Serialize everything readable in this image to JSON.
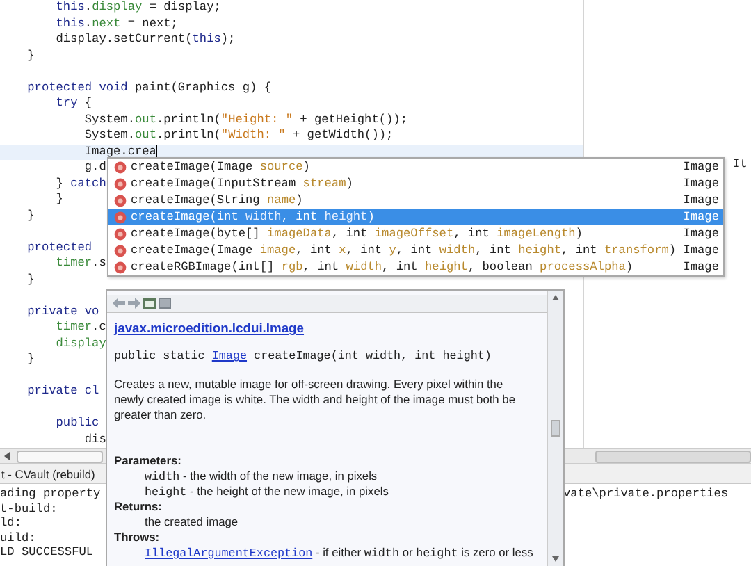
{
  "editor": {
    "lines": [
      {
        "current": false,
        "tokens": [
          {
            "text": "        this",
            "kind": "keyword"
          },
          {
            "text": ".",
            "kind": "plain"
          },
          {
            "text": "display",
            "kind": "field"
          },
          {
            "text": " = display;",
            "kind": "plain"
          }
        ]
      },
      {
        "current": false,
        "tokens": [
          {
            "text": "        this",
            "kind": "keyword"
          },
          {
            "text": ".",
            "kind": "plain"
          },
          {
            "text": "next",
            "kind": "field"
          },
          {
            "text": " = next;",
            "kind": "plain"
          }
        ]
      },
      {
        "current": false,
        "tokens": [
          {
            "text": "        display.setCurrent(",
            "kind": "plain"
          },
          {
            "text": "this",
            "kind": "keyword"
          },
          {
            "text": ");",
            "kind": "plain"
          }
        ]
      },
      {
        "current": false,
        "tokens": [
          {
            "text": "    }",
            "kind": "plain"
          }
        ]
      },
      {
        "current": false
      },
      {
        "current": false,
        "tokens": [
          {
            "text": "    protected void",
            "kind": "keyword"
          },
          {
            "text": " paint(Graphics g) {",
            "kind": "plain"
          }
        ]
      },
      {
        "current": false,
        "tokens": [
          {
            "text": "        try",
            "kind": "keyword"
          },
          {
            "text": " {",
            "kind": "plain"
          }
        ]
      },
      {
        "current": false,
        "tokens": [
          {
            "text": "            System.",
            "kind": "plain"
          },
          {
            "text": "out",
            "kind": "field"
          },
          {
            "text": ".println(",
            "kind": "plain"
          },
          {
            "text": "\"Height: \"",
            "kind": "string"
          },
          {
            "text": " + getHeight());",
            "kind": "plain"
          }
        ]
      },
      {
        "current": false,
        "tokens": [
          {
            "text": "            System.",
            "kind": "plain"
          },
          {
            "text": "out",
            "kind": "field"
          },
          {
            "text": ".println(",
            "kind": "plain"
          },
          {
            "text": "\"Width: \"",
            "kind": "string"
          },
          {
            "text": " + getWidth());",
            "kind": "plain"
          }
        ]
      },
      {
        "current": true,
        "tokens": [
          {
            "text": "            Image.crea",
            "kind": "plain"
          }
        ]
      },
      {
        "current": false,
        "tokens": [
          {
            "text": "            g.d",
            "kind": "plain"
          }
        ]
      },
      {
        "current": false,
        "tokens": [
          {
            "text": "        } ",
            "kind": "plain"
          },
          {
            "text": "catch",
            "kind": "keyword"
          }
        ]
      },
      {
        "current": false,
        "tokens": [
          {
            "text": "        }",
            "kind": "plain"
          }
        ]
      },
      {
        "current": false,
        "tokens": [
          {
            "text": "    }",
            "kind": "plain"
          }
        ]
      },
      {
        "current": false
      },
      {
        "current": false,
        "tokens": [
          {
            "text": "    protected",
            "kind": "keyword"
          }
        ]
      },
      {
        "current": false,
        "tokens": [
          {
            "text": "        timer",
            "kind": "field"
          },
          {
            "text": ".s",
            "kind": "plain"
          }
        ]
      },
      {
        "current": false,
        "tokens": [
          {
            "text": "    }",
            "kind": "plain"
          }
        ]
      },
      {
        "current": false
      },
      {
        "current": false,
        "tokens": [
          {
            "text": "    private vo",
            "kind": "keyword"
          }
        ]
      },
      {
        "current": false,
        "tokens": [
          {
            "text": "        timer",
            "kind": "field"
          },
          {
            "text": ".c",
            "kind": "plain"
          }
        ]
      },
      {
        "current": false,
        "tokens": [
          {
            "text": "        display",
            "kind": "field"
          }
        ]
      },
      {
        "current": false,
        "tokens": [
          {
            "text": "    }",
            "kind": "plain"
          }
        ]
      },
      {
        "current": false
      },
      {
        "current": false,
        "tokens": [
          {
            "text": "    private cl",
            "kind": "keyword"
          }
        ]
      },
      {
        "current": false
      },
      {
        "current": false,
        "tokens": [
          {
            "text": "        public",
            "kind": "keyword"
          }
        ]
      },
      {
        "current": false,
        "tokens": [
          {
            "text": "            dis",
            "kind": "plain"
          }
        ]
      }
    ]
  },
  "side_panel": {
    "text": "It"
  },
  "completion": {
    "items": [
      {
        "selected": false,
        "returns": "Image",
        "tokens": [
          {
            "text": "createImage(Image ",
            "kind": "plain"
          },
          {
            "text": "source",
            "kind": "param"
          },
          {
            "text": ")",
            "kind": "plain"
          }
        ]
      },
      {
        "selected": false,
        "returns": "Image",
        "tokens": [
          {
            "text": "createImage(InputStream ",
            "kind": "plain"
          },
          {
            "text": "stream",
            "kind": "param"
          },
          {
            "text": ")",
            "kind": "plain"
          }
        ]
      },
      {
        "selected": false,
        "returns": "Image",
        "tokens": [
          {
            "text": "createImage(String ",
            "kind": "plain"
          },
          {
            "text": "name",
            "kind": "param"
          },
          {
            "text": ")",
            "kind": "plain"
          }
        ]
      },
      {
        "selected": true,
        "returns": "Image",
        "tokens": [
          {
            "text": "createImage(int ",
            "kind": "plain"
          },
          {
            "text": "width",
            "kind": "param"
          },
          {
            "text": ", int ",
            "kind": "plain"
          },
          {
            "text": "height",
            "kind": "param"
          },
          {
            "text": ")",
            "kind": "plain"
          }
        ]
      },
      {
        "selected": false,
        "returns": "Image",
        "tokens": [
          {
            "text": "createImage(byte[] ",
            "kind": "plain"
          },
          {
            "text": "imageData",
            "kind": "param"
          },
          {
            "text": ", int ",
            "kind": "plain"
          },
          {
            "text": "imageOffset",
            "kind": "param"
          },
          {
            "text": ", int ",
            "kind": "plain"
          },
          {
            "text": "imageLength",
            "kind": "param"
          },
          {
            "text": ")",
            "kind": "plain"
          }
        ]
      },
      {
        "selected": false,
        "returns": "Image",
        "tokens": [
          {
            "text": "createImage(Image ",
            "kind": "plain"
          },
          {
            "text": "image",
            "kind": "param"
          },
          {
            "text": ", int ",
            "kind": "plain"
          },
          {
            "text": "x",
            "kind": "param"
          },
          {
            "text": ", int ",
            "kind": "plain"
          },
          {
            "text": "y",
            "kind": "param"
          },
          {
            "text": ", int ",
            "kind": "plain"
          },
          {
            "text": "width",
            "kind": "param"
          },
          {
            "text": ", int ",
            "kind": "plain"
          },
          {
            "text": "height",
            "kind": "param"
          },
          {
            "text": ", int ",
            "kind": "plain"
          },
          {
            "text": "transform",
            "kind": "param"
          },
          {
            "text": ")",
            "kind": "plain"
          }
        ]
      },
      {
        "selected": false,
        "returns": "Image",
        "tokens": [
          {
            "text": "createRGBImage(int[] ",
            "kind": "plain"
          },
          {
            "text": "rgb",
            "kind": "param"
          },
          {
            "text": ", int ",
            "kind": "plain"
          },
          {
            "text": "width",
            "kind": "param"
          },
          {
            "text": ", int ",
            "kind": "plain"
          },
          {
            "text": "height",
            "kind": "param"
          },
          {
            "text": ", boolean ",
            "kind": "plain"
          },
          {
            "text": "processAlpha",
            "kind": "param"
          },
          {
            "text": ")",
            "kind": "plain"
          }
        ]
      }
    ]
  },
  "javadoc": {
    "title": "javax.microedition.lcdui.Image",
    "signature": [
      {
        "text": "public static ",
        "kind": "code"
      },
      {
        "text": "Image",
        "kind": "codelink"
      },
      {
        "text": " createImage(int width, int height)",
        "kind": "code"
      }
    ],
    "description": "Creates a new, mutable image for off-screen drawing. Every pixel within the newly created image is white. The width and height of the image must both be greater than zero.",
    "sections": [
      {
        "heading": "Parameters:",
        "entries": [
          [
            {
              "text": "width",
              "kind": "code"
            },
            {
              "text": " - the width of the new image, in pixels",
              "kind": "text"
            }
          ],
          [
            {
              "text": "height",
              "kind": "code"
            },
            {
              "text": " - the height of the new image, in pixels",
              "kind": "text"
            }
          ]
        ]
      },
      {
        "heading": "Returns:",
        "entries": [
          [
            {
              "text": "the created image",
              "kind": "text"
            }
          ]
        ]
      },
      {
        "heading": "Throws:",
        "entries": [
          [
            {
              "text": "IllegalArgumentException",
              "kind": "codelink"
            },
            {
              "text": " - if either ",
              "kind": "text"
            },
            {
              "text": "width",
              "kind": "code"
            },
            {
              "text": " or ",
              "kind": "text"
            },
            {
              "text": "height",
              "kind": "code"
            },
            {
              "text": " is zero or less",
              "kind": "text"
            }
          ]
        ]
      }
    ]
  },
  "console": {
    "tab": "t - CVault (rebuild)",
    "lines": [
      "ading property",
      "t-build:",
      "ld:",
      "uild:",
      "LD SUCCESSFUL"
    ],
    "overflow_text": "vate\\private.properties"
  }
}
